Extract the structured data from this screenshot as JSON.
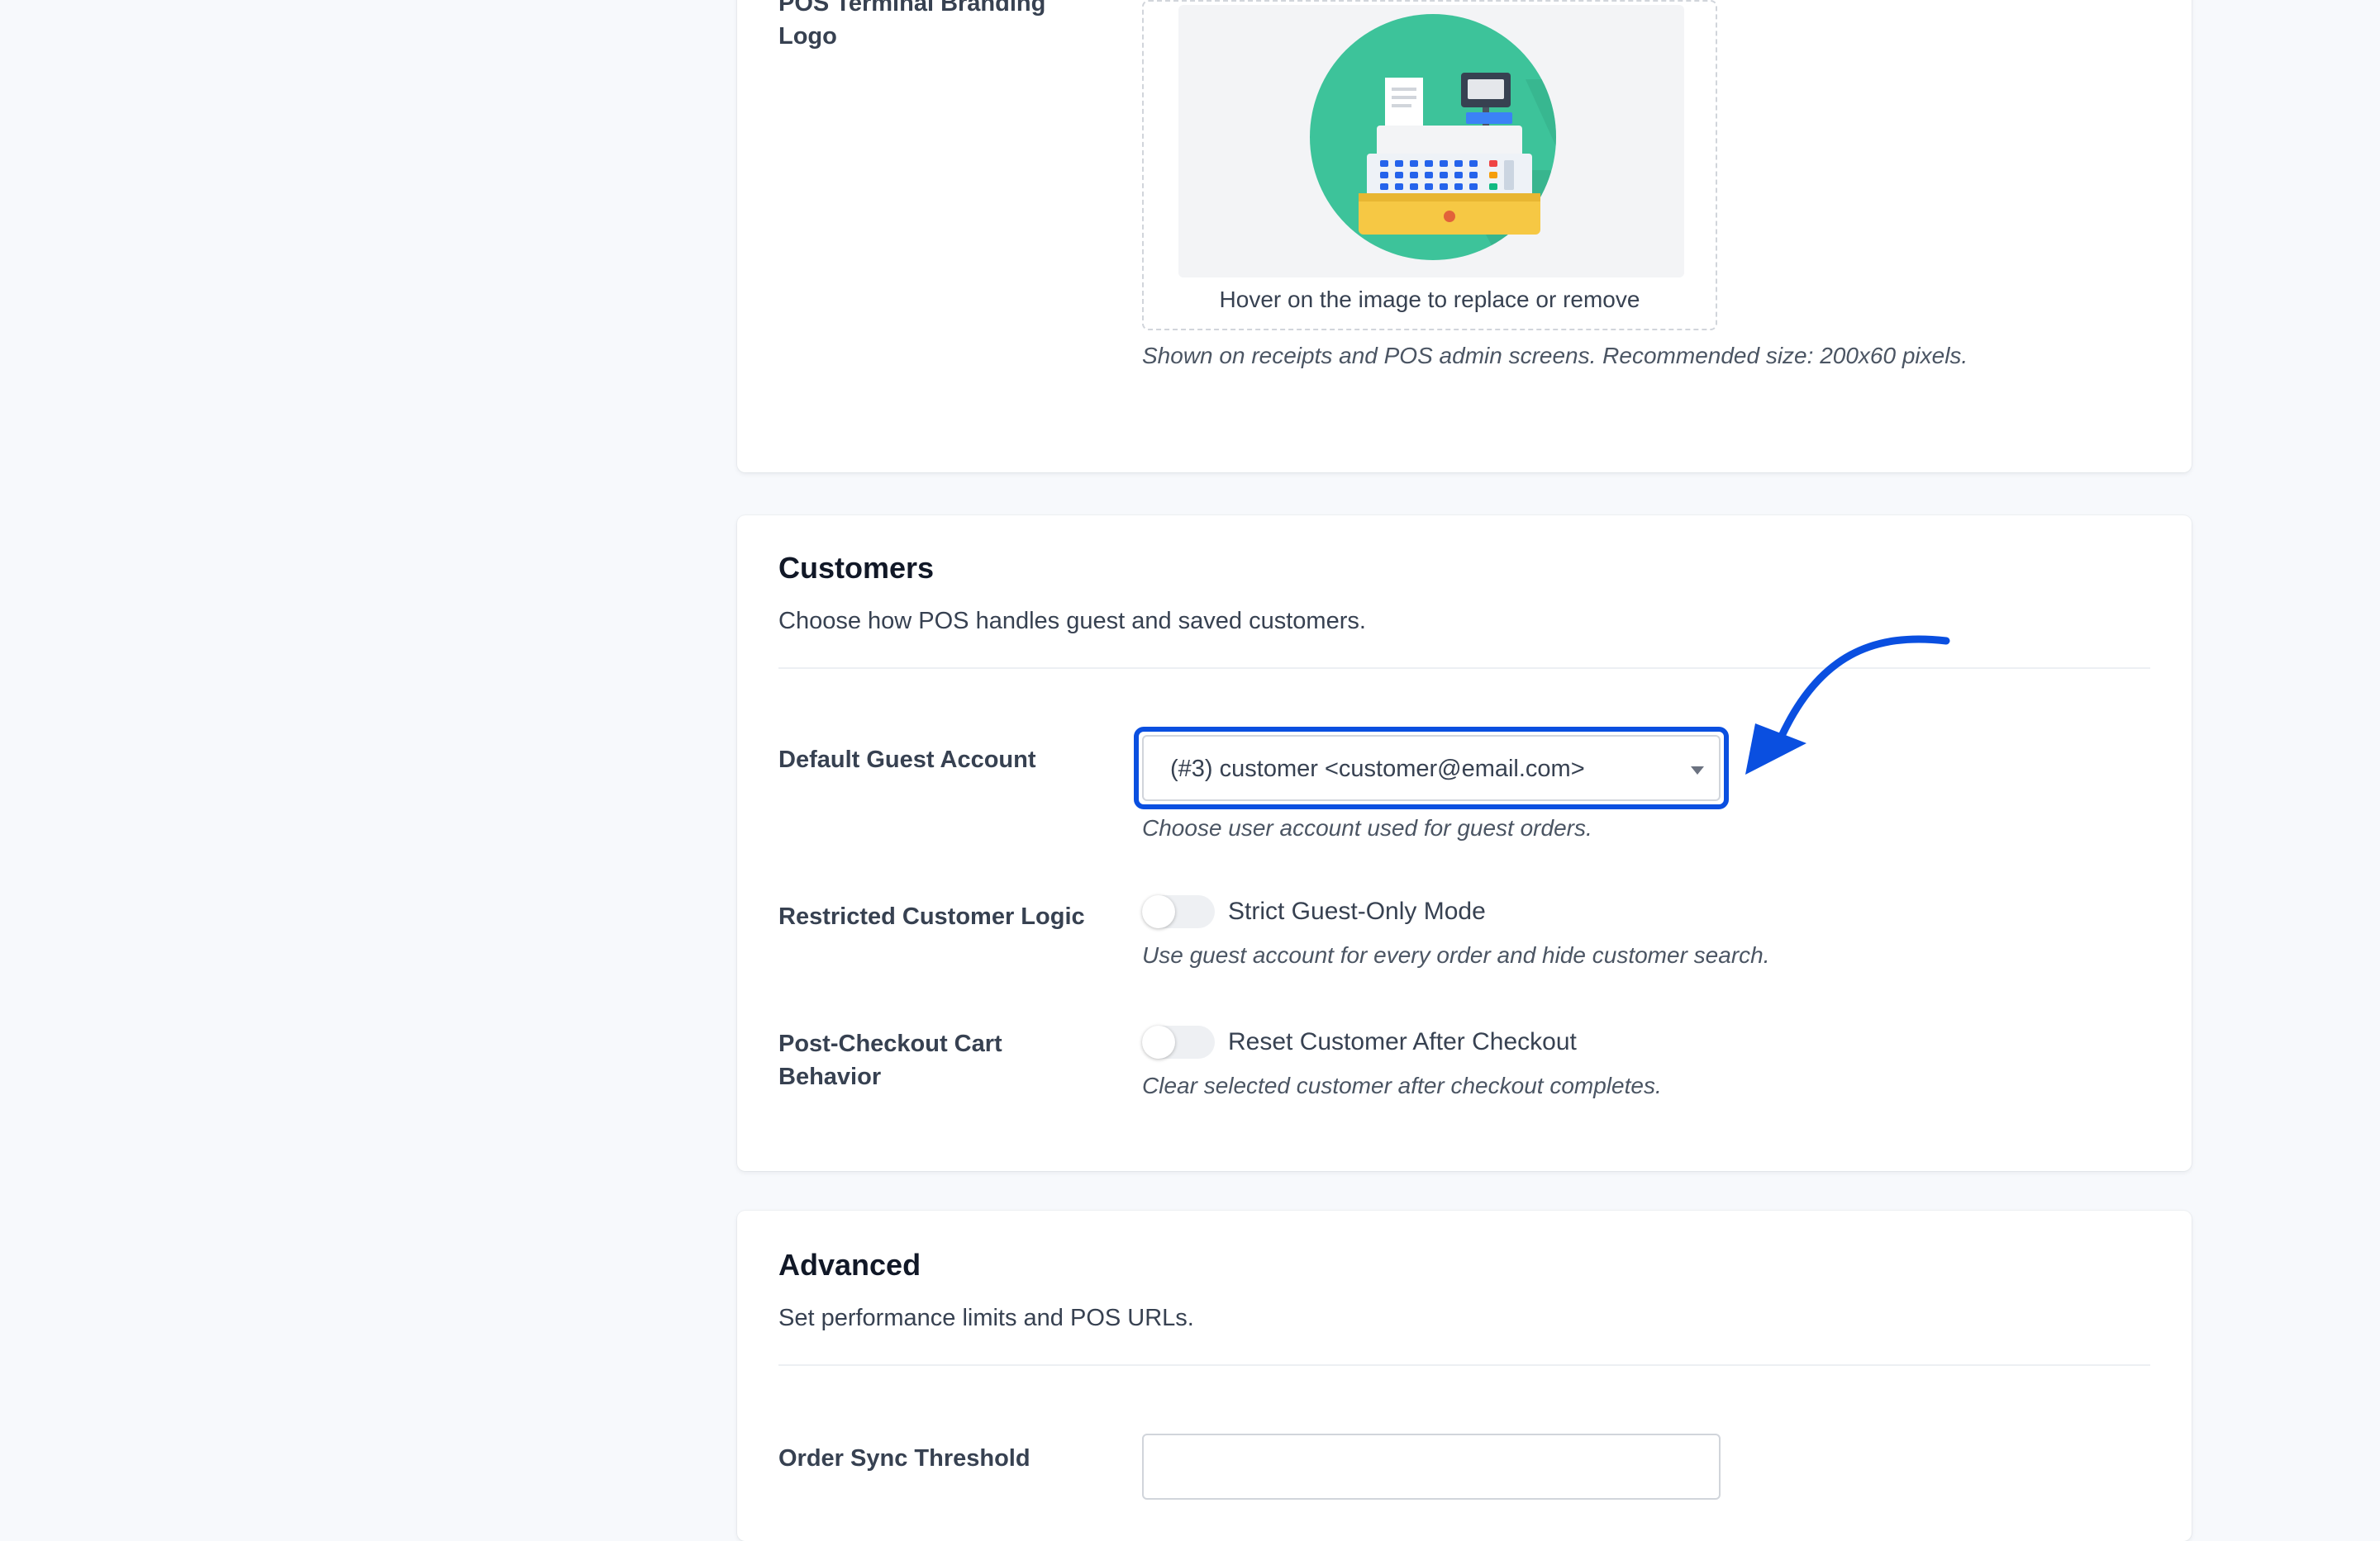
{
  "branding": {
    "label": "POS Terminal Branding Logo",
    "upload_hint": "Hover on the image to replace or remove",
    "help": "Shown on receipts and POS admin screens. Recommended size: 200x60 pixels.",
    "logo_icon": "cash-register-icon"
  },
  "customers": {
    "title": "Customers",
    "description": "Choose how POS handles guest and saved customers.",
    "default_guest": {
      "label": "Default Guest Account",
      "value": "(#3) customer <customer@email.com>",
      "help": "Choose user account used for guest orders."
    },
    "restricted": {
      "label": "Restricted Customer Logic",
      "toggle_label": "Strict Guest-Only Mode",
      "help": "Use guest account for every order and hide customer search."
    },
    "post_checkout": {
      "label": "Post-Checkout Cart Behavior",
      "toggle_label": "Reset Customer After Checkout",
      "help": "Clear selected customer after checkout completes."
    }
  },
  "advanced": {
    "title": "Advanced",
    "description": "Set performance limits and POS URLs.",
    "order_sync": {
      "label": "Order Sync Threshold",
      "value": ""
    }
  },
  "colors": {
    "highlight": "#0a4fe0",
    "page_bg": "#f7f9fc",
    "logo_green": "#3dc39a"
  }
}
